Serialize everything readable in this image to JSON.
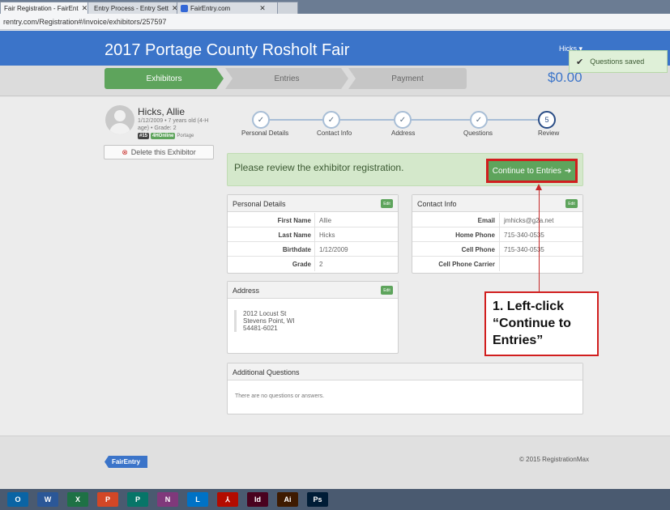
{
  "browser": {
    "tabs": [
      {
        "label": "Fair Registration - FairEnt",
        "active": true
      },
      {
        "label": "Entry Process - Entry Sett",
        "active": false
      },
      {
        "label": "FairEntry.com",
        "active": false
      }
    ],
    "url": "rentry.com/Registration#/invoice/exhibitors/257597"
  },
  "header": {
    "title": "2017 Portage County Rosholt Fair",
    "user_menu": "Hicks ▾",
    "total": "$0.00"
  },
  "toast": {
    "icon": "checkmark-icon",
    "text": "Questions saved"
  },
  "steps": [
    "Exhibitors",
    "Entries",
    "Payment"
  ],
  "exhibitor": {
    "name": "Hicks, Allie",
    "meta": "1/12/2009 • 7 years old (4-H age) • Grade: 2",
    "tag_number": "#15",
    "tag_online": "4HOnline",
    "county": "Portage",
    "delete_label": "Delete this Exhibitor"
  },
  "progress": {
    "steps": [
      {
        "label": "Personal Details",
        "mark": "✓"
      },
      {
        "label": "Contact Info",
        "mark": "✓"
      },
      {
        "label": "Address",
        "mark": "✓"
      },
      {
        "label": "Questions",
        "mark": "✓"
      },
      {
        "label": "Review",
        "mark": "5"
      }
    ]
  },
  "alert": {
    "text": "Please review the exhibitor registration.",
    "button": "Continue to Entries"
  },
  "personal_details": {
    "title": "Personal Details",
    "edit": "Edit",
    "rows": [
      {
        "k": "First Name",
        "v": "Allie"
      },
      {
        "k": "Last Name",
        "v": "Hicks"
      },
      {
        "k": "Birthdate",
        "v": "1/12/2009"
      },
      {
        "k": "Grade",
        "v": "2"
      }
    ]
  },
  "contact_info": {
    "title": "Contact Info",
    "edit": "Edit",
    "rows": [
      {
        "k": "Email",
        "v": "jmhicks@g2a.net"
      },
      {
        "k": "Home Phone",
        "v": "715-340-0535"
      },
      {
        "k": "Cell Phone",
        "v": "715-340-0535"
      },
      {
        "k": "Cell Phone Carrier",
        "v": ""
      }
    ]
  },
  "address": {
    "title": "Address",
    "edit": "Edit",
    "line1": "2012 Locust St",
    "line2": "Stevens Point, WI",
    "line3": "54481-6021"
  },
  "questions": {
    "title": "Additional Questions",
    "text": "There are no questions or answers."
  },
  "annotation": {
    "line1": "1. Left-click",
    "line2": "“Continue to",
    "line3": "Entries”"
  },
  "footer": {
    "logo": "FairEntry",
    "copyright": "© 2015 RegistrationMax"
  },
  "taskbar": [
    {
      "name": "outlook-icon",
      "label": "O",
      "color": "#0a64a4"
    },
    {
      "name": "word-icon",
      "label": "W",
      "color": "#2b5797"
    },
    {
      "name": "excel-icon",
      "label": "X",
      "color": "#1e7145"
    },
    {
      "name": "powerpoint-icon",
      "label": "P",
      "color": "#d24726"
    },
    {
      "name": "publisher-icon",
      "label": "P",
      "color": "#077568"
    },
    {
      "name": "onenote-icon",
      "label": "N",
      "color": "#80397b"
    },
    {
      "name": "lync-icon",
      "label": "L",
      "color": "#0072c6"
    },
    {
      "name": "acrobat-icon",
      "label": "⅄",
      "color": "#b30b00"
    },
    {
      "name": "indesign-icon",
      "label": "Id",
      "color": "#49021f"
    },
    {
      "name": "illustrator-icon",
      "label": "Ai",
      "color": "#3e1a00"
    },
    {
      "name": "photoshop-icon",
      "label": "Ps",
      "color": "#001c36"
    }
  ]
}
